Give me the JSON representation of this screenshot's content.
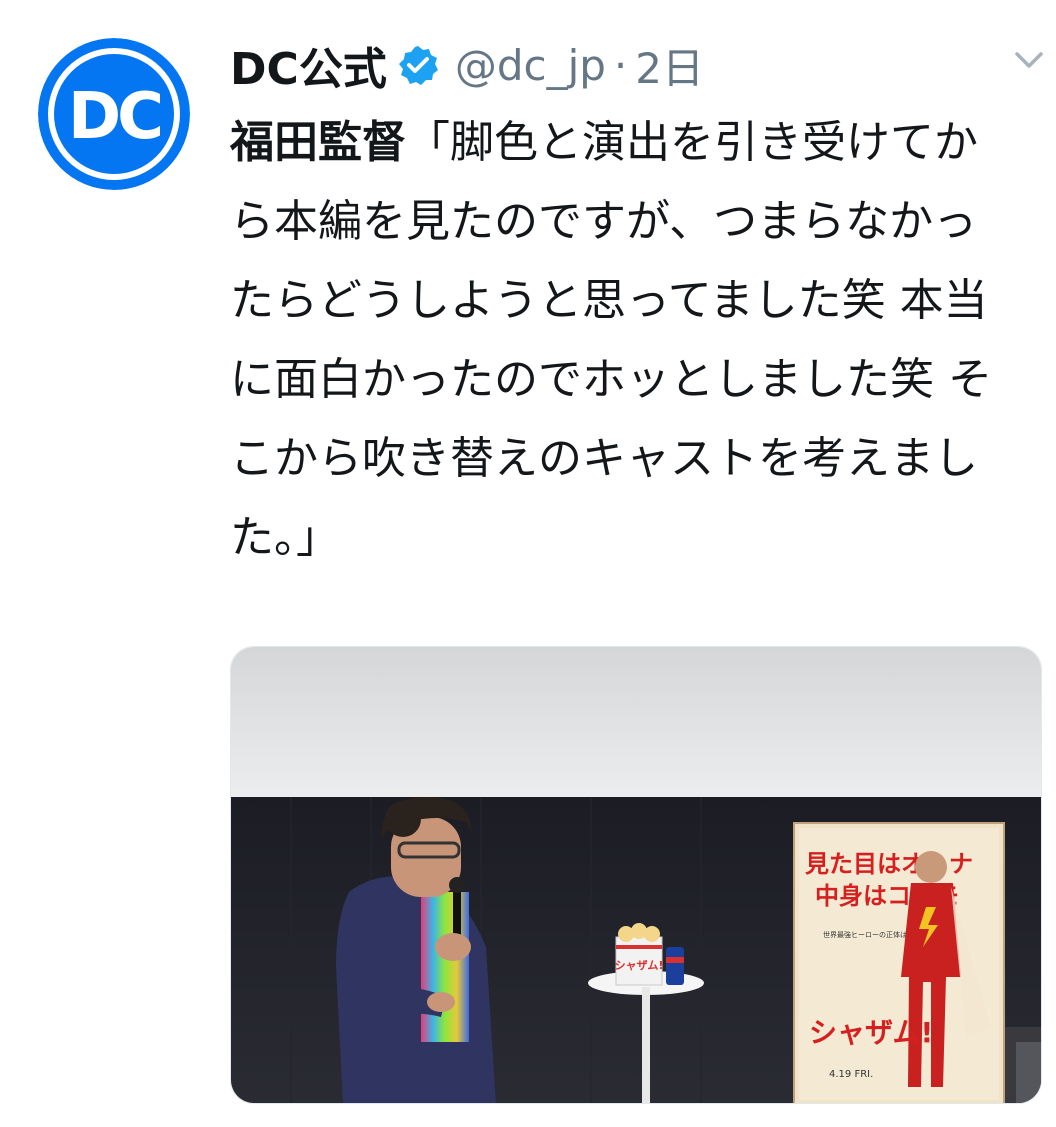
{
  "tweet": {
    "author_name": "DC公式",
    "handle": "@dc_jp",
    "separator": "·",
    "timestamp": "2日",
    "text_bold": "福田監督",
    "text_body": "「脚色と演出を引き受けてから本編を見たのですが、つまらなかったらどうしようと思ってました笑 本当に面白かったのでホッとしました笑 そこから吹き替えのキャストを考えました。」",
    "avatar_logo_text": "DC",
    "verified_icon": "verified-badge-icon",
    "menu_icon": "chevron-down-icon"
  },
  "photo": {
    "poster_line1": "見た目はオトナ",
    "poster_line2": "中身はコドモ",
    "poster_small": "世界最強ヒーローの正体は学校かよ。",
    "poster_title": "シャザム!",
    "poster_date": "4.19 FRI.",
    "cup_label": "シャザム!"
  },
  "colors": {
    "accent_blue": "#1da1f2",
    "dc_blue": "#0476f2",
    "muted": "#657786",
    "text": "#14171a"
  }
}
